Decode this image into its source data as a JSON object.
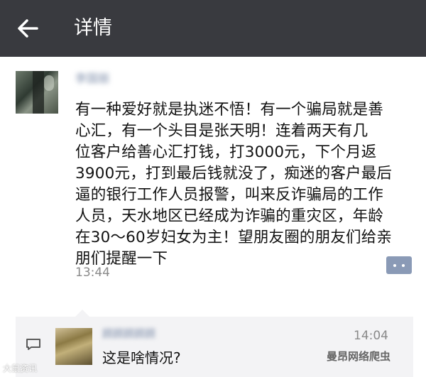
{
  "header": {
    "title": "详情",
    "background": "#393a3f"
  },
  "post": {
    "author": "李国丽",
    "lines": [
      "有一种爱好就是执迷不悟！有一个骗局就是善",
      "心汇，有一个头目是张天明！连着两天有几",
      "位客户给善心汇打钱，打3000元，下个月返",
      "3900元，打到最后钱就没了，痴迷的客户最后",
      "逼的银行工作人员报警，叫来反诈骗局的工作",
      "人员，天水地区已经成为诈骗的重灾区，年龄",
      "在30～60岁妇女为主！望朋友圈的朋友们给亲",
      "朋们提醒一下"
    ],
    "time": "13:44"
  },
  "comment": {
    "name": "顾顾顾顾顾",
    "time": "14:04",
    "text": "这是啥情况?"
  },
  "watermarks": {
    "left": "大鼠资讯",
    "right": "曼昂网络爬虫"
  },
  "icons": [
    "back-arrow-icon",
    "more-dots-icon",
    "comment-bubble-icon"
  ]
}
